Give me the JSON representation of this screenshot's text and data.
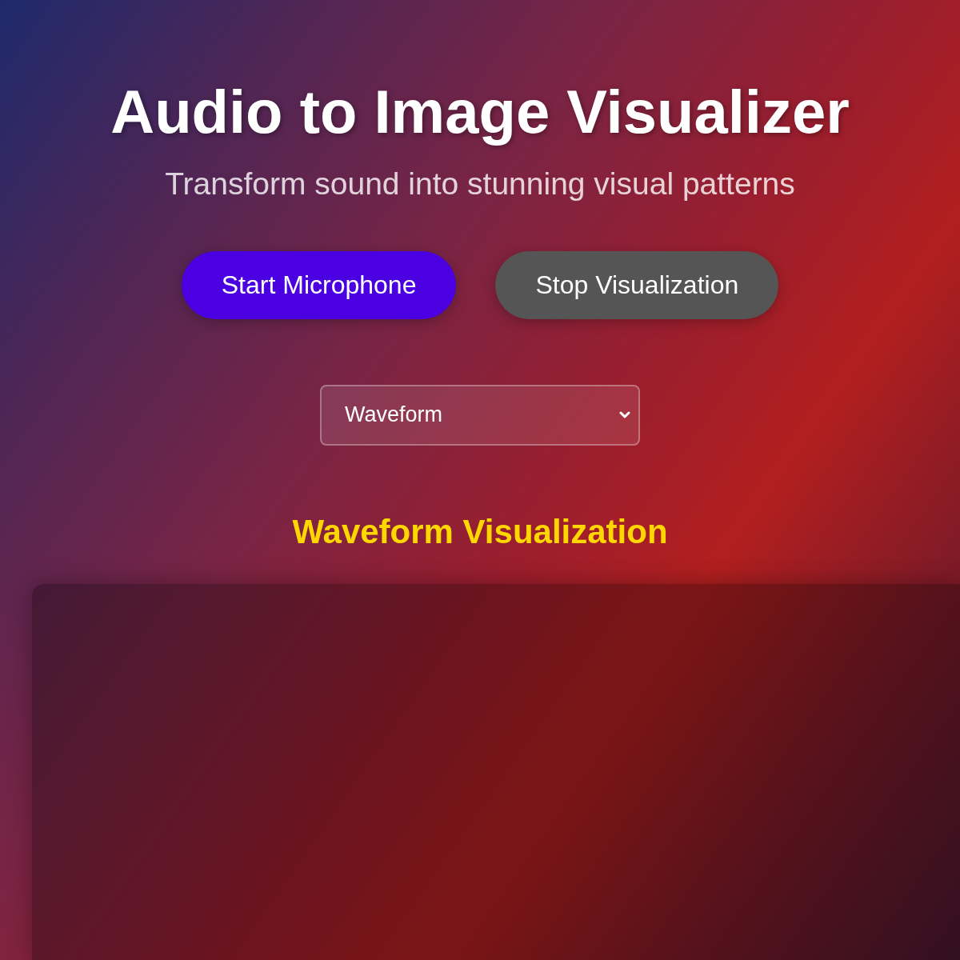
{
  "header": {
    "title": "Audio to Image Visualizer",
    "subtitle": "Transform sound into stunning visual patterns"
  },
  "buttons": [
    {
      "label": "Start Microphone",
      "kind": "primary"
    },
    {
      "label": "Stop Visualization",
      "kind": "secondary"
    }
  ],
  "mode_select": {
    "value": "Waveform"
  },
  "visualization": {
    "title": "Waveform Visualization"
  }
}
